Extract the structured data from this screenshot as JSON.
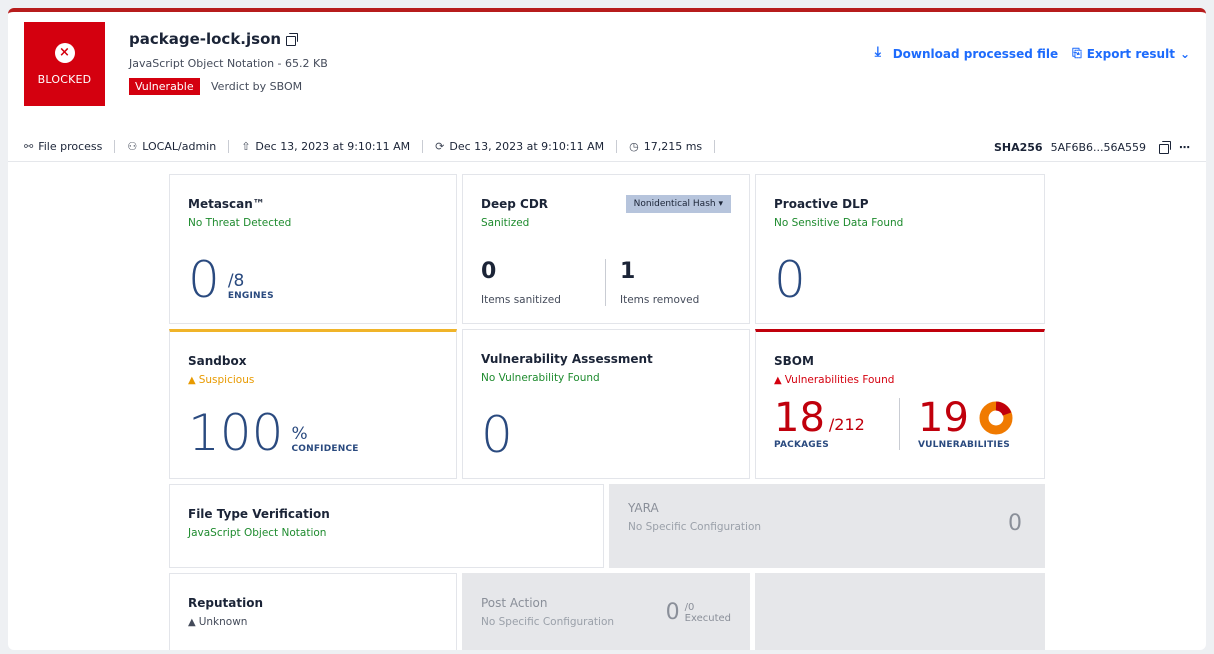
{
  "header": {
    "verdict": "BLOCKED",
    "file_name": "package-lock.json",
    "file_meta": "JavaScript Object Notation - 65.2 KB",
    "badge": "Vulnerable",
    "verdict_by": "Verdict by SBOM",
    "download_label": "Download processed file",
    "export_label": "Export result"
  },
  "meta_bar": {
    "file_process": "File process",
    "user": "LOCAL/admin",
    "uploaded": "Dec 13, 2023 at 9:10:11 AM",
    "processed": "Dec 13, 2023 at 9:10:11 AM",
    "duration": "17,215 ms",
    "sha_label": "SHA256",
    "sha_value": "5AF6B6...56A559"
  },
  "cards": {
    "metascan": {
      "title": "Metascan™",
      "status": "No Threat Detected",
      "value": "0",
      "total": "/8",
      "sub": "ENGINES"
    },
    "deep_cdr": {
      "title": "Deep CDR",
      "status": "Sanitized",
      "dropdown": "Nonidentical Hash",
      "sanitized_value": "0",
      "sanitized_label": "Items sanitized",
      "removed_value": "1",
      "removed_label": "Items removed"
    },
    "dlp": {
      "title": "Proactive DLP",
      "status": "No Sensitive Data Found",
      "value": "0"
    },
    "sandbox": {
      "title": "Sandbox",
      "status": "Suspicious",
      "value": "100",
      "unit": "%",
      "sub": "CONFIDENCE"
    },
    "vuln": {
      "title": "Vulnerability Assessment",
      "status": "No Vulnerability Found",
      "value": "0"
    },
    "sbom": {
      "title": "SBOM",
      "status": "Vulnerabilities Found",
      "packages_value": "18",
      "packages_total": "/212",
      "packages_label": "PACKAGES",
      "vuln_value": "19",
      "vuln_label": "VULNERABILITIES"
    },
    "ftv": {
      "title": "File Type Verification",
      "status": "JavaScript Object Notation"
    },
    "yara": {
      "title": "YARA",
      "status": "No Specific Configuration",
      "value": "0"
    },
    "reputation": {
      "title": "Reputation",
      "status": "Unknown"
    },
    "post_action": {
      "title": "Post Action",
      "status": "No Specific Configuration",
      "value": "0",
      "total": "/0",
      "sub": "Executed"
    }
  },
  "colors": {
    "blocked": "#d4000f",
    "accent": "#1d6bfc",
    "ok": "#1e8b2e",
    "warn": "#e89a00"
  }
}
